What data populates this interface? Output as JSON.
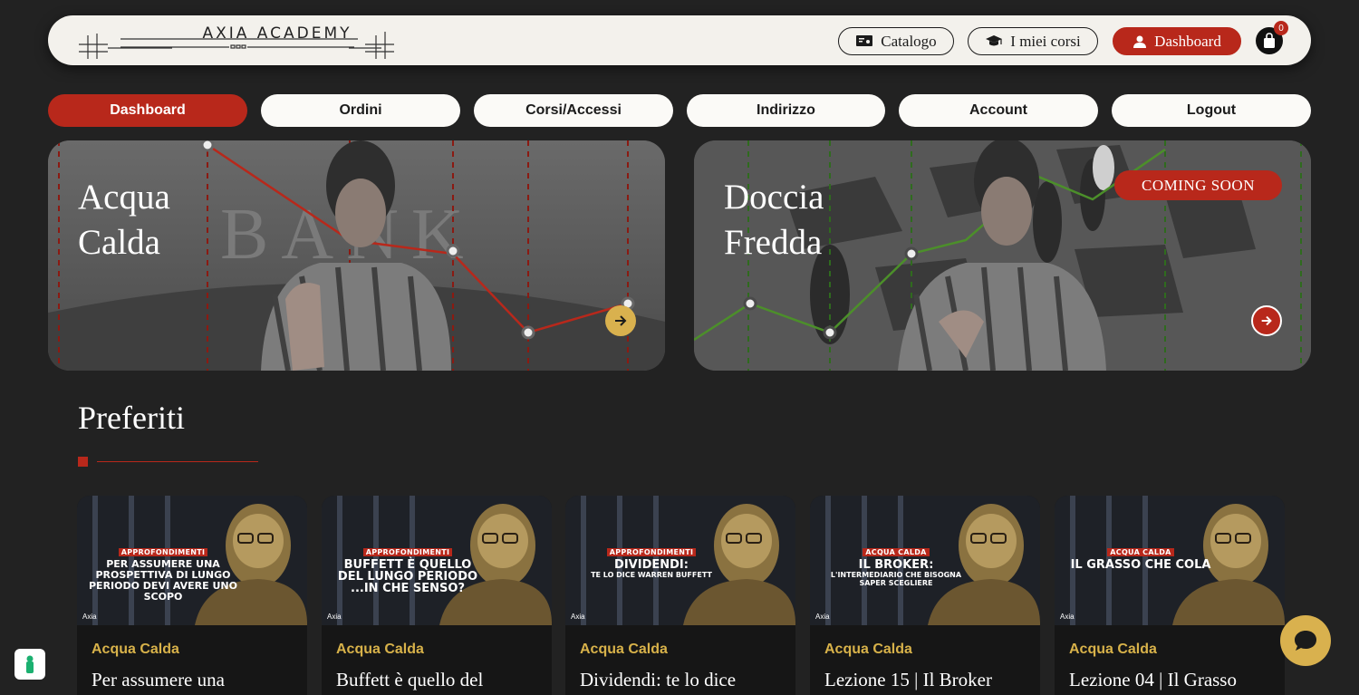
{
  "header": {
    "logo_text": "AXIA ACADEMY",
    "nav": [
      {
        "label": "Catalogo",
        "icon": "catalog-icon"
      },
      {
        "label": "I miei corsi",
        "icon": "graduation-cap-icon"
      },
      {
        "label": "Dashboard",
        "icon": "user-icon"
      }
    ],
    "cart_count": "0"
  },
  "tabs": [
    "Dashboard",
    "Ordini",
    "Corsi/Accessi",
    "Indirizzo",
    "Account",
    "Logout"
  ],
  "active_tab": "Dashboard",
  "heroes": [
    {
      "title_line1": "Acqua",
      "title_line2": "Calda",
      "badge": ""
    },
    {
      "title_line1": "Doccia",
      "title_line2": "Fredda",
      "badge": "COMING SOON"
    }
  ],
  "favorites": {
    "heading": "Preferiti",
    "cards": [
      {
        "thumb_tag": "APPROFONDIMENTI",
        "thumb_main": "PER ASSUMERE UNA PROSPETTIVA DI LUNGO PERIODO DEVI AVERE UNO SCOPO",
        "thumb_sub": "",
        "brand": "Axia",
        "category": "Acqua Calda",
        "title": "Per assumere una"
      },
      {
        "thumb_tag": "APPROFONDIMENTI",
        "thumb_main": "BUFFETT È QUELLO DEL LUNGO PERIODO ...IN CHE SENSO?",
        "thumb_sub": "",
        "brand": "Axia",
        "category": "Acqua Calda",
        "title": "Buffett è quello del"
      },
      {
        "thumb_tag": "APPROFONDIMENTI",
        "thumb_main": "DIVIDENDI:",
        "thumb_sub": "TE LO DICE WARREN BUFFETT",
        "brand": "Axia",
        "category": "Acqua Calda",
        "title": "Dividendi: te lo dice"
      },
      {
        "thumb_tag": "ACQUA CALDA",
        "thumb_main": "IL BROKER:",
        "thumb_sub": "L'INTERMEDIARIO CHE BISOGNA SAPER SCEGLIERE",
        "brand": "Axia",
        "category": "Acqua Calda",
        "title": "Lezione 15 | Il Broker"
      },
      {
        "thumb_tag": "ACQUA CALDA",
        "thumb_main": "IL GRASSO CHE COLA",
        "thumb_sub": "",
        "brand": "Axia",
        "category": "Acqua Calda",
        "title": "Lezione 04 | Il Grasso"
      }
    ]
  },
  "colors": {
    "accent_red": "#b8281b",
    "gold": "#d8b24a",
    "background": "#222222"
  }
}
